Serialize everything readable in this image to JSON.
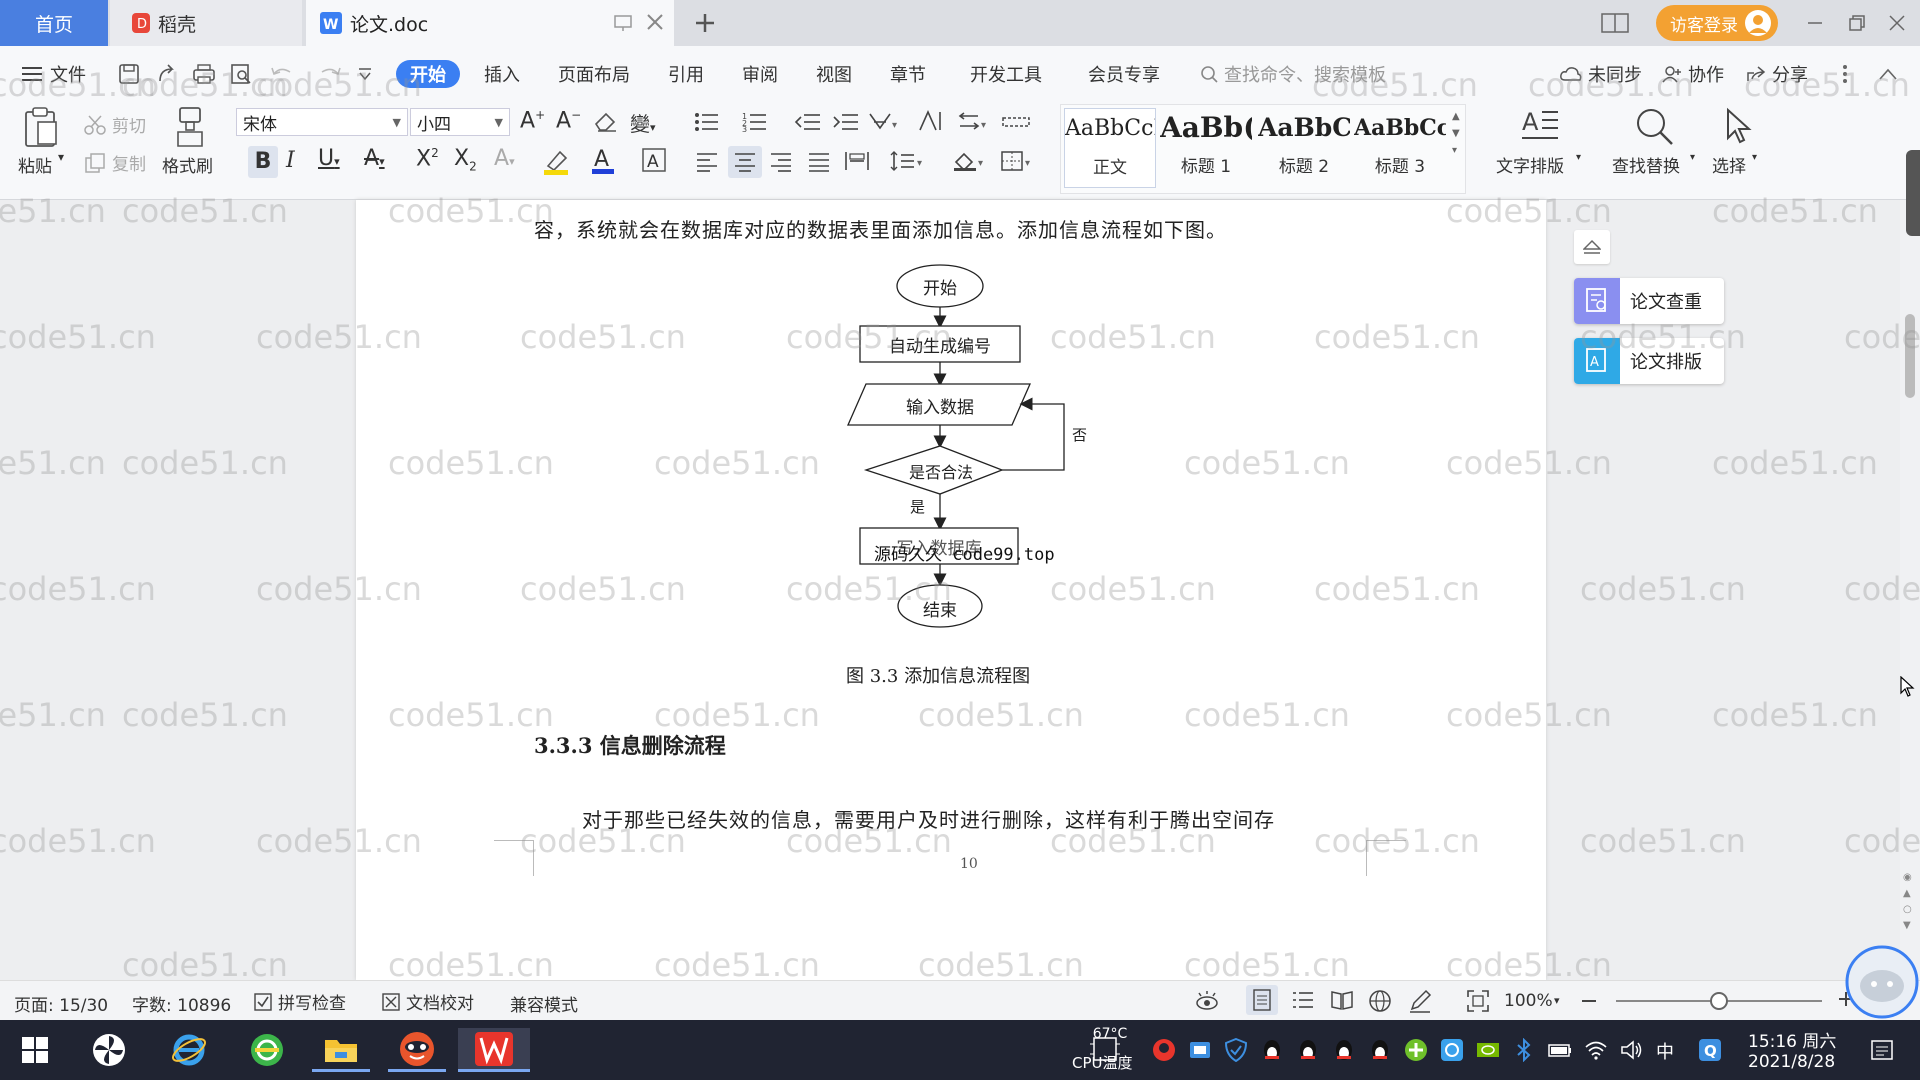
{
  "titlebar": {
    "tabs": [
      {
        "label": "首页"
      },
      {
        "label": "稻壳"
      },
      {
        "label": "论文.doc"
      }
    ],
    "visitor_login": "访客登录",
    "brand_color": "#4a7fe0"
  },
  "menubar": {
    "file": "文件",
    "items": [
      "开始",
      "插入",
      "页面布局",
      "引用",
      "审阅",
      "视图",
      "章节",
      "开发工具",
      "会员专享"
    ],
    "search_placeholder": "查找命令、搜索模板",
    "unsynced": "未同步",
    "collab": "协作",
    "share": "分享"
  },
  "ribbon": {
    "paste": "粘贴",
    "cut": "剪切",
    "copy": "复制",
    "format_painter": "格式刷",
    "font_name": "宋体",
    "font_size": "小四",
    "styles": [
      {
        "preview": "AaBbCcI",
        "label": "正文"
      },
      {
        "preview": "AaBb(",
        "label": "标题 1"
      },
      {
        "preview": "AaBbC",
        "label": "标题 2"
      },
      {
        "preview": "AaBbCcI",
        "label": "标题 3"
      }
    ],
    "text_layout": "文字排版",
    "find_replace": "查找替换",
    "select": "选择"
  },
  "document": {
    "intro_line": "容，系统就会在数据库对应的数据表里面添加信息。添加信息流程如下图。",
    "flowchart": {
      "start": "开始",
      "step1": "自动生成编号",
      "step2": "输入数据",
      "decision": "是否合法",
      "no_label": "否",
      "yes_label": "是",
      "step3": "写入数据库",
      "end": "结束",
      "overlay": "源码久久 code99.top"
    },
    "caption": "图 3.3  添加信息流程图",
    "heading": "3.3.3 信息删除流程",
    "paragraph": "对于那些已经失效的信息，需要用户及时进行删除，这样有利于腾出空间存",
    "page_number": "10"
  },
  "side_panel": {
    "check": "论文查重",
    "format": "论文排版"
  },
  "watermark": "code51.cn",
  "statusbar": {
    "page": "页面: 15/30",
    "words": "字数: 10896",
    "spell": "拼写检查",
    "proof": "文档校对",
    "compat": "兼容模式",
    "zoom": "100%",
    "zoom_level": 0.5
  },
  "taskbar": {
    "temp": "67°C",
    "cpu": "CPU温度",
    "ime": "中",
    "time": "15:16 周六",
    "date": "2021/8/28"
  }
}
